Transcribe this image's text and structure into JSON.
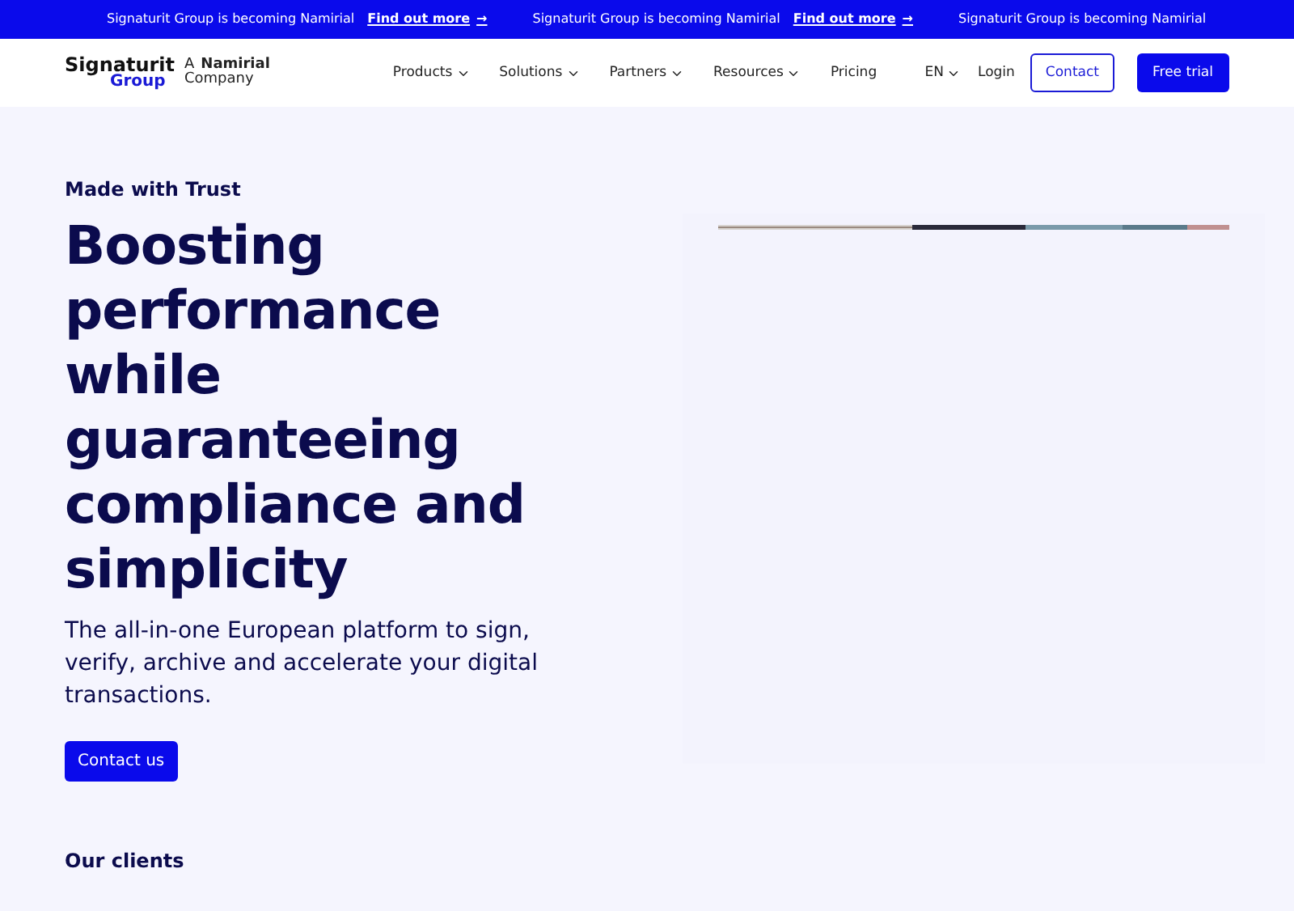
{
  "banner": [
    {
      "text": "Signaturit Group is becoming Namirial",
      "link": "Find out more",
      "arrow": "→"
    },
    {
      "text": "Signaturit Group is becoming Namirial",
      "link": "Find out more",
      "arrow": "→"
    },
    {
      "text": "Signaturit Group is becoming Namirial"
    }
  ],
  "logo": {
    "name": "Signaturit",
    "group": "Group",
    "tag_prefix": "A",
    "tag_brand": "Namirial",
    "tag_suffix": "Company"
  },
  "nav": [
    {
      "label": "Products",
      "dropdown": true
    },
    {
      "label": "Solutions",
      "dropdown": true
    },
    {
      "label": "Partners",
      "dropdown": true
    },
    {
      "label": "Resources",
      "dropdown": true
    },
    {
      "label": "Pricing",
      "dropdown": false
    }
  ],
  "language": "EN",
  "login": "Login",
  "contact": "Contact",
  "free_trial": "Free trial",
  "hero": {
    "eyebrow": "Made with Trust",
    "title": "Boosting performance while guaranteeing compliance and simplicity",
    "subtitle": "The all-in-one European platform to sign, verify, archive and accelerate your digital transactions.",
    "button": "Contact us"
  },
  "clients": {
    "eyebrow": "Our clients"
  }
}
